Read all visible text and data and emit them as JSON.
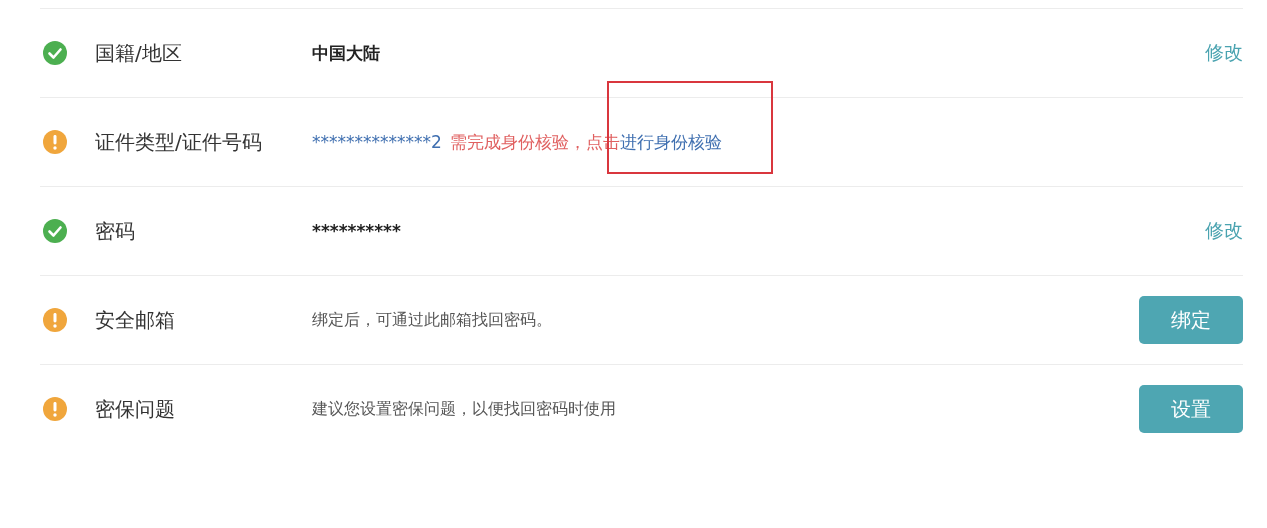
{
  "rows": [
    {
      "verified": true,
      "label": "国籍/地区",
      "value": {
        "kind": "strong",
        "text": "中国大陆"
      },
      "action": {
        "kind": "link",
        "label": "修改"
      }
    },
    {
      "verified": false,
      "label": "证件类型/证件号码",
      "value": {
        "kind": "verify",
        "number": "**************2",
        "notice": "需完成身份核验，点击",
        "link": "进行身份核验",
        "highlighted": true
      }
    },
    {
      "verified": true,
      "label": "密码",
      "value": {
        "kind": "strong",
        "text": "**********"
      },
      "action": {
        "kind": "link",
        "label": "修改"
      }
    },
    {
      "verified": false,
      "label": "安全邮箱",
      "value": {
        "kind": "hint",
        "text": "绑定后，可通过此邮箱找回密码。"
      },
      "action": {
        "kind": "button",
        "label": "绑定"
      }
    },
    {
      "verified": false,
      "label": "密保问题",
      "value": {
        "kind": "hint",
        "text": "建议您设置密保问题，以便找回密码时使用"
      },
      "action": {
        "kind": "button",
        "label": "设置"
      }
    }
  ]
}
